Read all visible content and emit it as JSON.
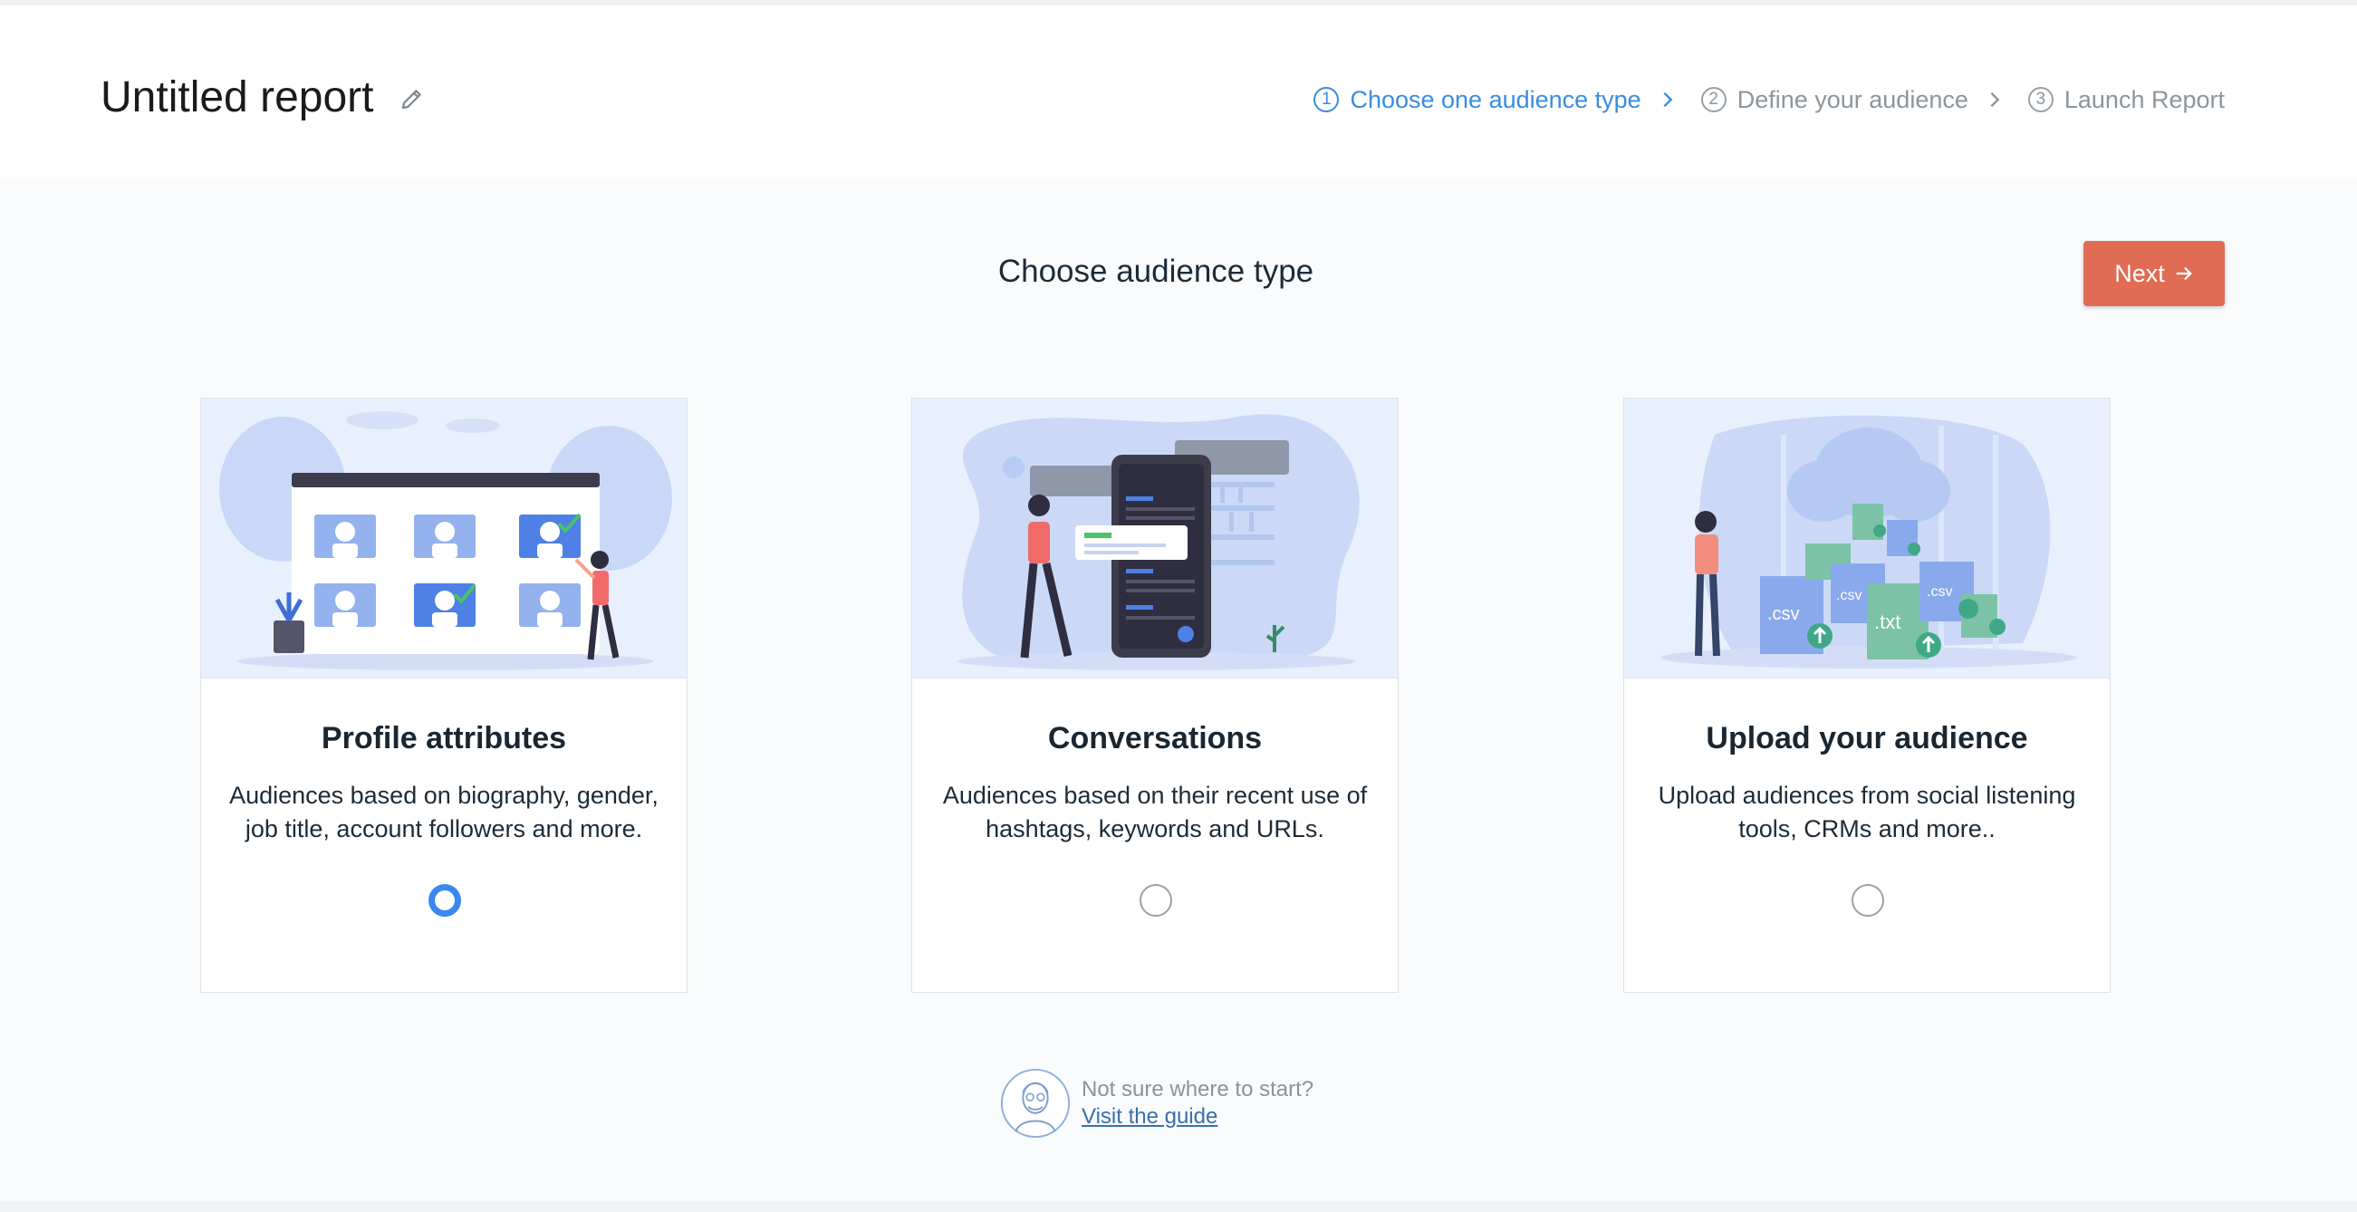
{
  "header": {
    "title": "Untitled report",
    "edit_icon": "pencil-icon"
  },
  "steps": [
    {
      "num": "1",
      "label": "Choose one audience type",
      "active": true
    },
    {
      "num": "2",
      "label": "Define your audience",
      "active": false
    },
    {
      "num": "3",
      "label": "Launch Report",
      "active": false
    }
  ],
  "main": {
    "title": "Choose audience type",
    "next_label": "Next"
  },
  "cards": [
    {
      "title": "Profile attributes",
      "desc": "Audiences based on biography, gender, job title, account followers and more.",
      "selected": true
    },
    {
      "title": "Conversations",
      "desc": "Audiences based on their recent use of hashtags, keywords and URLs.",
      "selected": false
    },
    {
      "title": "Upload your audience",
      "desc": "Upload audiences from social listening tools, CRMs and more..",
      "selected": false
    }
  ],
  "illustration_text": {
    "csv": ".csv",
    "txt": ".txt"
  },
  "guide": {
    "hint": "Not sure where to start?",
    "link": "Visit the guide"
  },
  "colors": {
    "accent": "#3b8cde",
    "primary_button": "#e06c55",
    "radio_selected": "#3b87f0"
  }
}
